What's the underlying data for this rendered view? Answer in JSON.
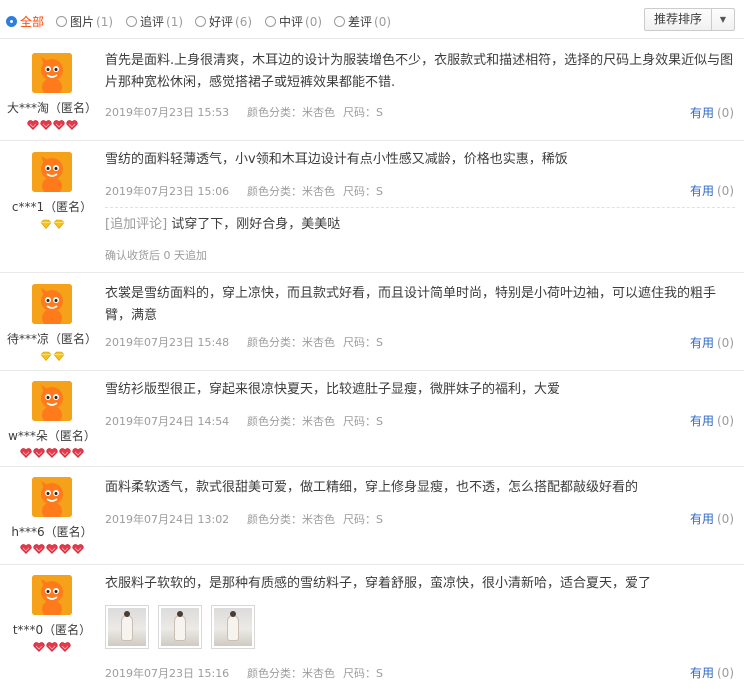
{
  "filters": [
    {
      "label": "全部",
      "count": "",
      "active": true
    },
    {
      "label": "图片",
      "count": "(1)"
    },
    {
      "label": "追评",
      "count": "(1)"
    },
    {
      "label": "好评",
      "count": "(6)"
    },
    {
      "label": "中评",
      "count": "(0)"
    },
    {
      "label": "差评",
      "count": "(0)"
    }
  ],
  "sort": {
    "label": "推荐排序"
  },
  "meta_labels": {
    "color": "颜色分类：",
    "size": "尺码：",
    "useful": "有用"
  },
  "reviews": [
    {
      "user": "大***淘（匿名）",
      "rank": "red-heart",
      "rank_count": 4,
      "text": "首先是面料.上身很清爽，木耳边的设计为服装增色不少，衣服款式和描述相符，选择的尺码上身效果近似与图片那种宽松休闲，感觉搭裙子或短裤效果都能不错.",
      "date": "2019年07月23日 15:53",
      "color": "米杏色",
      "size": "S",
      "useful_count": "(0)"
    },
    {
      "user": "c***1（匿名）",
      "rank": "yellow-diamond",
      "rank_count": 2,
      "text": "雪纺的面料轻薄透气，小v领和木耳边设计有点小性感又减龄，价格也实惠，稀饭",
      "date": "2019年07月23日 15:06",
      "color": "米杏色",
      "size": "S",
      "useful_count": "(0)",
      "append_tag": "[追加评论]",
      "append_text": "试穿了下，刚好合身，美美哒",
      "append_note": "确认收货后 0 天追加"
    },
    {
      "user": "待***凉（匿名）",
      "rank": "yellow-diamond",
      "rank_count": 2,
      "text": "衣裳是雪纺面料的，穿上凉快，而且款式好看，而且设计简单时尚，特别是小荷叶边袖，可以遮住我的粗手臂，满意",
      "date": "2019年07月23日 15:48",
      "color": "米杏色",
      "size": "S",
      "useful_count": "(0)"
    },
    {
      "user": "w***朵（匿名）",
      "rank": "red-heart",
      "rank_count": 5,
      "text": "雪纺衫版型很正，穿起来很凉快夏天，比较遮肚子显瘦，微胖妹子的福利，大爱",
      "date": "2019年07月24日 14:54",
      "color": "米杏色",
      "size": "S",
      "useful_count": "(0)"
    },
    {
      "user": "h***6（匿名）",
      "rank": "red-heart",
      "rank_count": 5,
      "text": "面料柔软透气，款式很甜美可爱，做工精细，穿上修身显瘦，也不透，怎么搭配都敲级好看的",
      "date": "2019年07月24日 13:02",
      "color": "米杏色",
      "size": "S",
      "useful_count": "(0)"
    },
    {
      "user": "t***0（匿名）",
      "rank": "red-heart",
      "rank_count": 3,
      "text": "衣服料子软软的，是那种有质感的雪纺料子，穿着舒服，蛮凉快，很小清新哈，适合夏天，爱了",
      "date": "2019年07月23日 15:16",
      "color": "米杏色",
      "size": "S",
      "useful_count": "(0)",
      "photos": 3
    }
  ]
}
